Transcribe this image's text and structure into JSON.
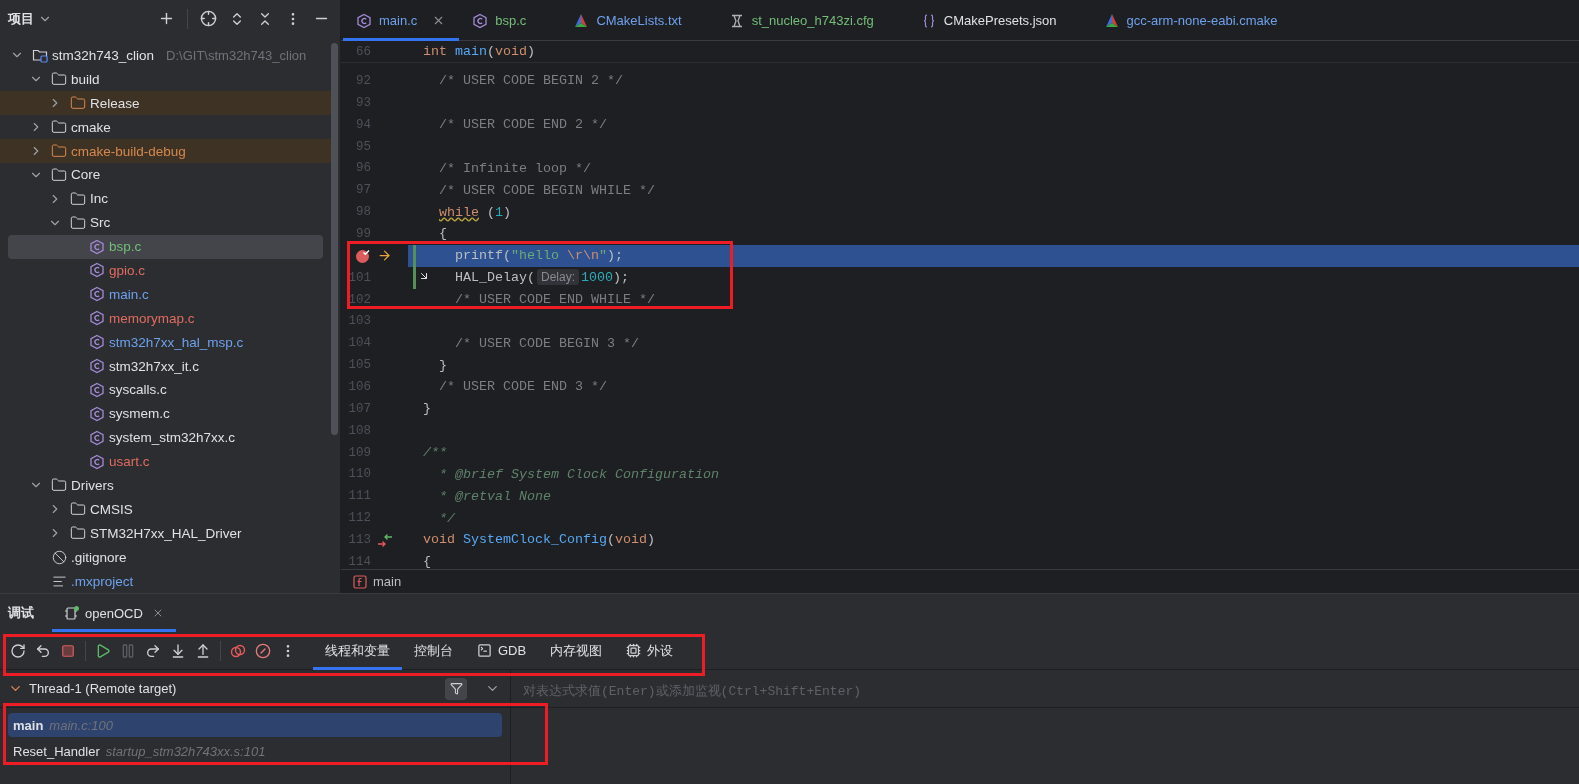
{
  "sidebar": {
    "title": "项目",
    "tree": [
      {
        "label": "stm32h743_clion",
        "path": "D:\\GIT\\stm32h743_clion",
        "kind": "module",
        "expanded": true,
        "selected": false,
        "ignored": false,
        "color": "#dfe1e5",
        "children": [
          {
            "label": "build",
            "kind": "folder",
            "expanded": true,
            "selected": false,
            "ignored": false,
            "color": "#dfe1e5",
            "children": [
              {
                "label": "Release",
                "kind": "folder",
                "expanded": false,
                "selected": false,
                "ignored": true,
                "color": "#dfe1e5"
              }
            ]
          },
          {
            "label": "cmake",
            "kind": "folder",
            "expanded": false,
            "selected": false,
            "ignored": false,
            "color": "#dfe1e5"
          },
          {
            "label": "cmake-build-debug",
            "kind": "folder",
            "expanded": false,
            "selected": false,
            "ignored": true,
            "color": "#d6884f"
          },
          {
            "label": "Core",
            "kind": "folder",
            "expanded": true,
            "selected": false,
            "ignored": false,
            "color": "#dfe1e5",
            "children": [
              {
                "label": "Inc",
                "kind": "folder",
                "expanded": false,
                "selected": false,
                "ignored": false,
                "color": "#dfe1e5"
              },
              {
                "label": "Src",
                "kind": "folder",
                "expanded": true,
                "selected": false,
                "ignored": false,
                "color": "#dfe1e5",
                "children": [
                  {
                    "label": "bsp.c",
                    "kind": "c-file",
                    "selected": true,
                    "ignored": false,
                    "color": "#73bd79"
                  },
                  {
                    "label": "gpio.c",
                    "kind": "c-file",
                    "selected": false,
                    "ignored": false,
                    "color": "#e06c60"
                  },
                  {
                    "label": "main.c",
                    "kind": "c-file",
                    "selected": false,
                    "ignored": false,
                    "color": "#6ea1ec"
                  },
                  {
                    "label": "memorymap.c",
                    "kind": "c-file",
                    "selected": false,
                    "ignored": false,
                    "color": "#e06c60"
                  },
                  {
                    "label": "stm32h7xx_hal_msp.c",
                    "kind": "c-file",
                    "selected": false,
                    "ignored": false,
                    "color": "#6ea1ec"
                  },
                  {
                    "label": "stm32h7xx_it.c",
                    "kind": "c-file",
                    "selected": false,
                    "ignored": false,
                    "color": "#dfe1e5"
                  },
                  {
                    "label": "syscalls.c",
                    "kind": "c-file",
                    "selected": false,
                    "ignored": false,
                    "color": "#dfe1e5"
                  },
                  {
                    "label": "sysmem.c",
                    "kind": "c-file",
                    "selected": false,
                    "ignored": false,
                    "color": "#dfe1e5"
                  },
                  {
                    "label": "system_stm32h7xx.c",
                    "kind": "c-file",
                    "selected": false,
                    "ignored": false,
                    "color": "#dfe1e5"
                  },
                  {
                    "label": "usart.c",
                    "kind": "c-file",
                    "selected": false,
                    "ignored": false,
                    "color": "#e06c60"
                  }
                ]
              }
            ]
          },
          {
            "label": "Drivers",
            "kind": "folder",
            "expanded": true,
            "selected": false,
            "ignored": false,
            "color": "#dfe1e5",
            "children": [
              {
                "label": "CMSIS",
                "kind": "folder",
                "expanded": false,
                "selected": false,
                "ignored": false,
                "color": "#dfe1e5"
              },
              {
                "label": "STM32H7xx_HAL_Driver",
                "kind": "folder",
                "expanded": false,
                "selected": false,
                "ignored": false,
                "color": "#dfe1e5"
              }
            ]
          },
          {
            "label": ".gitignore",
            "kind": "ignore-file",
            "selected": false,
            "ignored": false,
            "color": "#dfe1e5"
          },
          {
            "label": ".mxproject",
            "kind": "text-file",
            "selected": false,
            "ignored": false,
            "color": "#6ea1ec"
          }
        ]
      }
    ]
  },
  "editor": {
    "tabs": [
      {
        "label": "main.c",
        "kind": "c",
        "selected": true,
        "color": "#6ea1ec"
      },
      {
        "label": "bsp.c",
        "kind": "c",
        "selected": false,
        "color": "#73bd79"
      },
      {
        "label": "CMakeLists.txt",
        "kind": "cmake",
        "selected": false,
        "color": "#6ea1ec"
      },
      {
        "label": "st_nucleo_h743zi.cfg",
        "kind": "cfg",
        "selected": false,
        "color": "#73bd79"
      },
      {
        "label": "CMakePresets.json",
        "kind": "json",
        "selected": false,
        "color": "#dfe1e5"
      },
      {
        "label": "gcc-arm-none-eabi.cmake",
        "kind": "cmake",
        "selected": false,
        "color": "#6ea1ec"
      }
    ],
    "sticky_line": {
      "number": "66",
      "tokens": [
        {
          "kind": "keyword",
          "text": "int "
        },
        {
          "kind": "function",
          "text": "main"
        },
        {
          "kind": "plain",
          "text": "("
        },
        {
          "kind": "keyword",
          "text": "void"
        },
        {
          "kind": "plain",
          "text": ")"
        }
      ]
    },
    "lines": [
      {
        "number": "92",
        "current": false,
        "changed": false,
        "tokens": [
          {
            "kind": "comment",
            "text": "  /* USER CODE BEGIN 2 */"
          }
        ]
      },
      {
        "number": "93",
        "current": false,
        "changed": false
      },
      {
        "number": "94",
        "current": false,
        "changed": false,
        "tokens": [
          {
            "kind": "comment",
            "text": "  /* USER CODE END 2 */"
          }
        ]
      },
      {
        "number": "95",
        "current": false,
        "changed": false
      },
      {
        "number": "96",
        "current": false,
        "changed": false,
        "tokens": [
          {
            "kind": "comment",
            "text": "  /* Infinite loop */"
          }
        ]
      },
      {
        "number": "97",
        "current": false,
        "changed": false,
        "tokens": [
          {
            "kind": "comment",
            "text": "  /* USER CODE BEGIN WHILE */"
          }
        ]
      },
      {
        "number": "98",
        "current": false,
        "changed": false,
        "tokens": [
          {
            "kind": "keyword-warning",
            "text": "  while"
          },
          {
            "kind": "plain",
            "text": " ("
          },
          {
            "kind": "number",
            "text": "1"
          },
          {
            "kind": "plain",
            "text": ")"
          }
        ]
      },
      {
        "number": "99",
        "current": false,
        "changed": false,
        "tokens": [
          {
            "kind": "plain",
            "text": "  {"
          }
        ]
      },
      {
        "current": true,
        "changed": true,
        "kind": "breakpoint",
        "tokens": [
          {
            "kind": "plain",
            "text": "    printf("
          },
          {
            "kind": "string",
            "text": "\"hello "
          },
          {
            "kind": "escape",
            "text": "\\r\\n"
          },
          {
            "kind": "string",
            "text": "\""
          },
          {
            "kind": "plain",
            "text": ");"
          }
        ]
      },
      {
        "number": "101",
        "current": false,
        "changed": true,
        "kind": "step-into",
        "tokens": [
          {
            "kind": "plain",
            "text": "    HAL_Delay("
          },
          {
            "kind": "hint",
            "text": "Delay:"
          },
          {
            "kind": "number",
            "text": "1000"
          },
          {
            "kind": "plain",
            "text": ");"
          }
        ]
      },
      {
        "number": "102",
        "current": false,
        "changed": false,
        "tokens": [
          {
            "kind": "comment",
            "text": "    /* USER CODE END WHILE */"
          }
        ]
      },
      {
        "number": "103",
        "current": false,
        "changed": false
      },
      {
        "number": "104",
        "current": false,
        "changed": false,
        "tokens": [
          {
            "kind": "comment",
            "text": "    /* USER CODE BEGIN 3 */"
          }
        ]
      },
      {
        "number": "105",
        "current": false,
        "changed": false,
        "tokens": [
          {
            "kind": "plain",
            "text": "  }"
          }
        ]
      },
      {
        "number": "106",
        "current": false,
        "changed": false,
        "tokens": [
          {
            "kind": "comment",
            "text": "  /* USER CODE END 3 */"
          }
        ]
      },
      {
        "number": "107",
        "current": false,
        "changed": false,
        "tokens": [
          {
            "kind": "plain",
            "text": "}"
          }
        ]
      },
      {
        "number": "108",
        "current": false,
        "changed": false
      },
      {
        "number": "109",
        "current": false,
        "changed": false,
        "tokens": [
          {
            "kind": "doc",
            "text": "/**"
          }
        ]
      },
      {
        "number": "110",
        "current": false,
        "changed": false,
        "tokens": [
          {
            "kind": "doc",
            "text": "  * "
          },
          {
            "kind": "doc",
            "text": "@brief"
          },
          {
            "kind": "doc",
            "text": " System Clock Configuration"
          }
        ]
      },
      {
        "number": "111",
        "current": false,
        "changed": false,
        "tokens": [
          {
            "kind": "doc",
            "text": "  * "
          },
          {
            "kind": "doc",
            "text": "@retval"
          },
          {
            "kind": "doc",
            "text": " None"
          }
        ]
      },
      {
        "number": "112",
        "current": false,
        "changed": false,
        "tokens": [
          {
            "kind": "doc",
            "text": "  */"
          }
        ]
      },
      {
        "number": "113",
        "current": false,
        "changed": false,
        "kind": "implements",
        "tokens": [
          {
            "kind": "keyword",
            "text": "void "
          },
          {
            "kind": "function",
            "text": "SystemClock_Config"
          },
          {
            "kind": "plain",
            "text": "("
          },
          {
            "kind": "keyword",
            "text": "void"
          },
          {
            "kind": "plain",
            "text": ")"
          }
        ]
      },
      {
        "number": "114",
        "current": false,
        "changed": false,
        "tokens": [
          {
            "kind": "plain",
            "text": "{"
          }
        ]
      }
    ],
    "outlined": true,
    "breadcrumb": "main"
  },
  "debugger": {
    "title": "调试",
    "sessions": [
      {
        "label": "openOCD",
        "selected": true
      }
    ],
    "actions": [
      {
        "kind": "rerun",
        "disabled": false
      },
      {
        "kind": "reset",
        "disabled": false
      },
      {
        "kind": "stop",
        "disabled": false
      },
      {
        "kind": "resume",
        "disabled": false
      },
      {
        "kind": "pause",
        "disabled": true
      },
      {
        "kind": "step-over",
        "disabled": false
      },
      {
        "kind": "step-into",
        "disabled": false
      },
      {
        "kind": "step-out",
        "disabled": false
      },
      {
        "kind": "breakpoints",
        "disabled": false
      },
      {
        "kind": "mute-breakpoints",
        "disabled": false
      },
      {
        "kind": "more",
        "disabled": false
      }
    ],
    "tool_tabs": [
      {
        "label": "线程和变量",
        "kind": "text",
        "selected": true
      },
      {
        "label": "控制台",
        "kind": "text",
        "selected": false
      },
      {
        "label": "GDB",
        "kind": "terminal",
        "selected": false
      },
      {
        "label": "内存视图",
        "kind": "text",
        "selected": false
      },
      {
        "label": "外设",
        "kind": "chip",
        "selected": false
      }
    ],
    "toolbar_outlined": true,
    "thread": "Thread-1 (Remote target)",
    "frames": [
      {
        "function": "main",
        "location": "main.c:100",
        "selected": true
      },
      {
        "function": "Reset_Handler",
        "location": "startup_stm32h743xx.s:101",
        "selected": false
      }
    ],
    "frames_outlined": true,
    "watch_placeholder": "对表达式求值(Enter)或添加监视(Ctrl+Shift+Enter)"
  }
}
